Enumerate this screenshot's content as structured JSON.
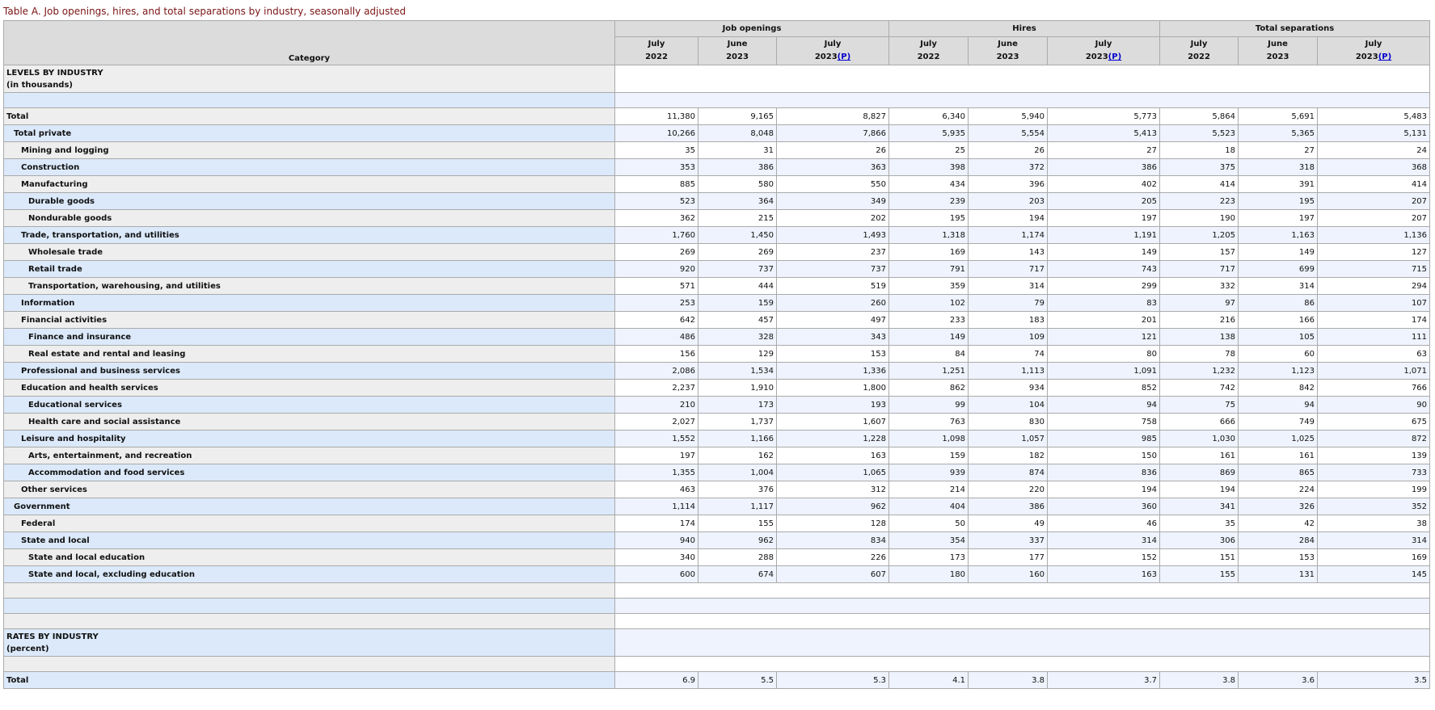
{
  "caption": "Table A. Job openings, hires, and total separations by industry, seasonally adjusted",
  "header": {
    "category": "Category",
    "groups": [
      "Job openings",
      "Hires",
      "Total separations"
    ],
    "periods": [
      {
        "month": "July",
        "year": "2022",
        "prelim": ""
      },
      {
        "month": "June",
        "year": "2023",
        "prelim": ""
      },
      {
        "month": "July",
        "year": "2023",
        "prelim": "(P)"
      }
    ]
  },
  "levels": {
    "title_line1": "LEVELS BY INDUSTRY",
    "title_line2": "(in thousands)"
  },
  "rates": {
    "title_line1": "RATES BY INDUSTRY",
    "title_line2": "(percent)"
  },
  "rows": [
    {
      "name": "Total",
      "indent": 0,
      "values": [
        "11,380",
        "9,165",
        "8,827",
        "6,340",
        "5,940",
        "5,773",
        "5,864",
        "5,691",
        "5,483"
      ]
    },
    {
      "name": "Total private",
      "indent": 1,
      "values": [
        "10,266",
        "8,048",
        "7,866",
        "5,935",
        "5,554",
        "5,413",
        "5,523",
        "5,365",
        "5,131"
      ]
    },
    {
      "name": "Mining and logging",
      "indent": 2,
      "values": [
        "35",
        "31",
        "26",
        "25",
        "26",
        "27",
        "18",
        "27",
        "24"
      ]
    },
    {
      "name": "Construction",
      "indent": 2,
      "values": [
        "353",
        "386",
        "363",
        "398",
        "372",
        "386",
        "375",
        "318",
        "368"
      ]
    },
    {
      "name": "Manufacturing",
      "indent": 2,
      "values": [
        "885",
        "580",
        "550",
        "434",
        "396",
        "402",
        "414",
        "391",
        "414"
      ]
    },
    {
      "name": "Durable goods",
      "indent": 3,
      "values": [
        "523",
        "364",
        "349",
        "239",
        "203",
        "205",
        "223",
        "195",
        "207"
      ]
    },
    {
      "name": "Nondurable goods",
      "indent": 3,
      "values": [
        "362",
        "215",
        "202",
        "195",
        "194",
        "197",
        "190",
        "197",
        "207"
      ]
    },
    {
      "name": "Trade, transportation, and utilities",
      "indent": 2,
      "values": [
        "1,760",
        "1,450",
        "1,493",
        "1,318",
        "1,174",
        "1,191",
        "1,205",
        "1,163",
        "1,136"
      ]
    },
    {
      "name": "Wholesale trade",
      "indent": 3,
      "values": [
        "269",
        "269",
        "237",
        "169",
        "143",
        "149",
        "157",
        "149",
        "127"
      ]
    },
    {
      "name": "Retail trade",
      "indent": 3,
      "values": [
        "920",
        "737",
        "737",
        "791",
        "717",
        "743",
        "717",
        "699",
        "715"
      ]
    },
    {
      "name": "Transportation, warehousing, and utilities",
      "indent": 3,
      "values": [
        "571",
        "444",
        "519",
        "359",
        "314",
        "299",
        "332",
        "314",
        "294"
      ]
    },
    {
      "name": "Information",
      "indent": 2,
      "values": [
        "253",
        "159",
        "260",
        "102",
        "79",
        "83",
        "97",
        "86",
        "107"
      ]
    },
    {
      "name": "Financial activities",
      "indent": 2,
      "values": [
        "642",
        "457",
        "497",
        "233",
        "183",
        "201",
        "216",
        "166",
        "174"
      ]
    },
    {
      "name": "Finance and insurance",
      "indent": 3,
      "values": [
        "486",
        "328",
        "343",
        "149",
        "109",
        "121",
        "138",
        "105",
        "111"
      ]
    },
    {
      "name": "Real estate and rental and leasing",
      "indent": 3,
      "values": [
        "156",
        "129",
        "153",
        "84",
        "74",
        "80",
        "78",
        "60",
        "63"
      ]
    },
    {
      "name": "Professional and business services",
      "indent": 2,
      "values": [
        "2,086",
        "1,534",
        "1,336",
        "1,251",
        "1,113",
        "1,091",
        "1,232",
        "1,123",
        "1,071"
      ]
    },
    {
      "name": "Education and health services",
      "indent": 2,
      "values": [
        "2,237",
        "1,910",
        "1,800",
        "862",
        "934",
        "852",
        "742",
        "842",
        "766"
      ]
    },
    {
      "name": "Educational services",
      "indent": 3,
      "values": [
        "210",
        "173",
        "193",
        "99",
        "104",
        "94",
        "75",
        "94",
        "90"
      ]
    },
    {
      "name": "Health care and social assistance",
      "indent": 3,
      "values": [
        "2,027",
        "1,737",
        "1,607",
        "763",
        "830",
        "758",
        "666",
        "749",
        "675"
      ]
    },
    {
      "name": "Leisure and hospitality",
      "indent": 2,
      "values": [
        "1,552",
        "1,166",
        "1,228",
        "1,098",
        "1,057",
        "985",
        "1,030",
        "1,025",
        "872"
      ]
    },
    {
      "name": "Arts, entertainment, and recreation",
      "indent": 3,
      "values": [
        "197",
        "162",
        "163",
        "159",
        "182",
        "150",
        "161",
        "161",
        "139"
      ]
    },
    {
      "name": "Accommodation and food services",
      "indent": 3,
      "values": [
        "1,355",
        "1,004",
        "1,065",
        "939",
        "874",
        "836",
        "869",
        "865",
        "733"
      ]
    },
    {
      "name": "Other services",
      "indent": 2,
      "values": [
        "463",
        "376",
        "312",
        "214",
        "220",
        "194",
        "194",
        "224",
        "199"
      ]
    },
    {
      "name": "Government",
      "indent": 1,
      "values": [
        "1,114",
        "1,117",
        "962",
        "404",
        "386",
        "360",
        "341",
        "326",
        "352"
      ]
    },
    {
      "name": "Federal",
      "indent": 2,
      "values": [
        "174",
        "155",
        "128",
        "50",
        "49",
        "46",
        "35",
        "42",
        "38"
      ]
    },
    {
      "name": "State and local",
      "indent": 2,
      "values": [
        "940",
        "962",
        "834",
        "354",
        "337",
        "314",
        "306",
        "284",
        "314"
      ]
    },
    {
      "name": "State and local education",
      "indent": 3,
      "values": [
        "340",
        "288",
        "226",
        "173",
        "177",
        "152",
        "151",
        "153",
        "169"
      ]
    },
    {
      "name": "State and local, excluding education",
      "indent": 3,
      "values": [
        "600",
        "674",
        "607",
        "180",
        "160",
        "163",
        "155",
        "131",
        "145"
      ]
    }
  ],
  "rate_rows": [
    {
      "name": "Total",
      "indent": 0,
      "values": [
        "6.9",
        "5.5",
        "5.3",
        "4.1",
        "3.8",
        "3.7",
        "3.8",
        "3.6",
        "3.5"
      ]
    }
  ]
}
